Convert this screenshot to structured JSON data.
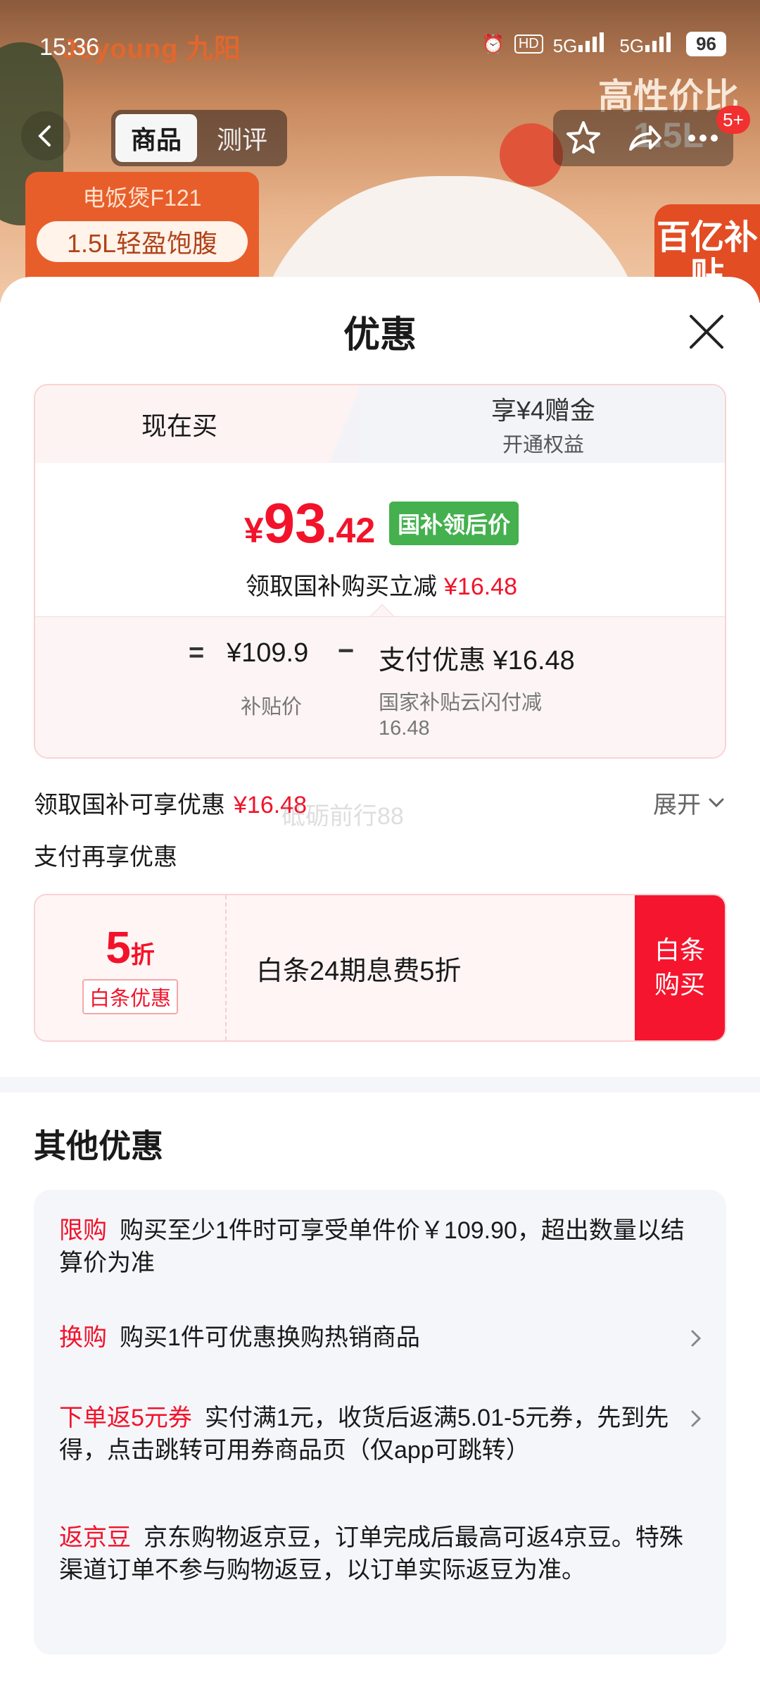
{
  "status_bar": {
    "time": "15:36",
    "hd": "HD",
    "net1": "5G",
    "net2": "5G",
    "battery": "96"
  },
  "hero": {
    "brand": "Joyoung 九阳",
    "tabs": [
      "商品",
      "测评"
    ],
    "active_tab": 0,
    "cart_badge": "5+",
    "promo_model": "电饭煲F121",
    "promo_pill": "1.5L轻盈饱腹",
    "side_text": "高性价比",
    "side_size": "1.5L",
    "subsidy_text": "百亿补贴"
  },
  "sheet": {
    "title": "优惠",
    "tabs": {
      "now_label": "现在买",
      "other_title": "享¥4赠金",
      "other_sub": "开通权益"
    },
    "price": {
      "symbol": "¥",
      "integer": "93",
      "decimal": ".42",
      "tag": "国补领后价",
      "sub_label": "领取国补购买立减",
      "sub_value": "¥16.48"
    },
    "breakdown": {
      "eq": "=",
      "price": "¥109.9",
      "price_label": "补贴价",
      "minus": "−",
      "discount": "支付优惠 ¥16.48",
      "discount_label": "国家补贴云闪付减16.48"
    },
    "subsidy_row": {
      "label": "领取国补可享优惠",
      "value": "¥16.48",
      "expand": "展开"
    },
    "watermark": "砥砺前行88",
    "pay_more": "支付再享优惠",
    "baitiao": {
      "discount_num": "5",
      "discount_unit": "折",
      "tag": "白条优惠",
      "text": "白条24期息费5折",
      "button": "白条购买"
    },
    "other": {
      "title": "其他优惠",
      "items": [
        {
          "tag": "限购",
          "text": "购买至少1件时可享受单件价￥109.90，超出数量以结算价为准",
          "has_arrow": false
        },
        {
          "tag": "换购",
          "text": "购买1件可优惠换购热销商品",
          "has_arrow": true
        },
        {
          "tag": "下单返5元券",
          "text": "实付满1元，收货后返满5.01-5元券，先到先得，点击跳转可用券商品页（仅app可跳转）",
          "has_arrow": true
        },
        {
          "tag": "返京豆",
          "text": "京东购物返京豆，订单完成后最高可返4京豆。特殊渠道订单不参与购物返豆，以订单实际返豆为准。",
          "has_arrow": false
        }
      ]
    }
  },
  "colors": {
    "accent_red": "#f2132a",
    "tag_green": "#44b04e",
    "card_border": "#fbd2d2"
  }
}
